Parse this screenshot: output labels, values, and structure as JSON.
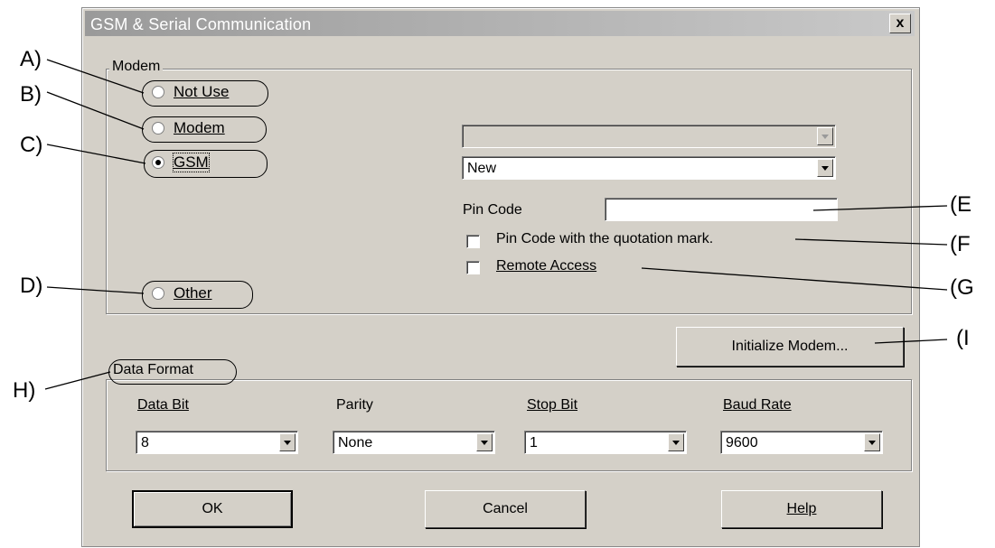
{
  "dialog": {
    "title": "GSM & Serial Communication",
    "close_label": "x"
  },
  "modem_group": {
    "label": "Modem",
    "options": [
      {
        "label": "Not Use",
        "checked": false
      },
      {
        "label": "Modem",
        "checked": false
      },
      {
        "label": "GSM",
        "checked": true
      },
      {
        "label": "Other",
        "checked": false
      }
    ],
    "modem_select_value": "",
    "gsm_select_value": "New",
    "pin_code_label": "Pin Code",
    "pin_code_value": "",
    "pin_quote_checkbox_label": "Pin Code with the quotation mark.",
    "pin_quote_checked": false,
    "remote_access_label": "Remote Access",
    "remote_access_checked": false
  },
  "initialize_button_label": "Initialize Modem...",
  "data_format": {
    "label": "Data Format",
    "data_bit_label": "Data Bit",
    "data_bit_value": "8",
    "parity_label": "Parity",
    "parity_value": "None",
    "stop_bit_label": "Stop Bit",
    "stop_bit_value": "1",
    "baud_rate_label": "Baud Rate",
    "baud_rate_value": "9600"
  },
  "buttons": {
    "ok": "OK",
    "cancel": "Cancel",
    "help": "Help"
  },
  "annotations": {
    "a": "A)",
    "b": "B)",
    "c": "C)",
    "d": "D)",
    "e": "(E",
    "f": "(F",
    "g": "(G",
    "h": "H)",
    "i": "(I"
  }
}
